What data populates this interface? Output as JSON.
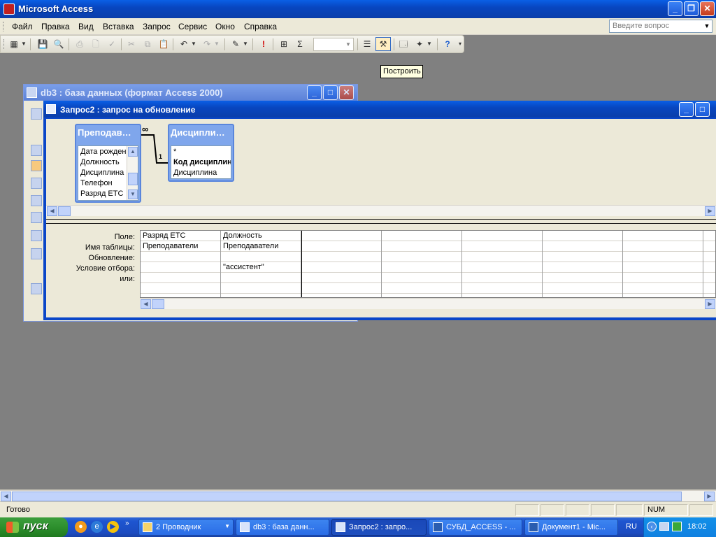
{
  "app": {
    "title": "Microsoft Access",
    "colors": {
      "title_blue": "#0a46c8",
      "face": "#ece9d8",
      "workspace": "#808080",
      "start_green": "#2d8f2d"
    }
  },
  "menubar": {
    "items": [
      "Файл",
      "Правка",
      "Вид",
      "Вставка",
      "Запрос",
      "Сервис",
      "Окно",
      "Справка"
    ],
    "ask_placeholder": "Введите вопрос"
  },
  "toolbar": {
    "sigma": "Σ",
    "tooltip": "Построить"
  },
  "db_window": {
    "title": "db3 : база данных (формат Access 2000)"
  },
  "query_window": {
    "title": "Запрос2 : запрос на обновление",
    "field_lists": [
      {
        "title": "Преподав…",
        "fields": [
          "Дата рождения",
          "Должность",
          "Дисциплина",
          "Телефон",
          "Разряд  ETC"
        ]
      },
      {
        "title": "Дисципли…",
        "fields": [
          "*",
          "Код дисциплины",
          "Дисциплина"
        ],
        "bold_field_index": 1
      }
    ],
    "relation": {
      "one_label": "1",
      "many_label": "∞"
    },
    "qbe": {
      "row_labels": [
        "Поле:",
        "Имя таблицы:",
        "Обновление:",
        "Условие отбора:",
        "или:"
      ],
      "columns": [
        {
          "field": "Разряд  ETC",
          "table": "Преподаватели",
          "update": "",
          "criteria": "",
          "or": ""
        },
        {
          "field": "Должность",
          "table": "Преподаватели",
          "update": "",
          "criteria": "\"ассистент\"",
          "or": ""
        }
      ]
    }
  },
  "statusbar": {
    "text": "Готово",
    "num": "NUM"
  },
  "taskbar": {
    "start_label": "пуск",
    "tasks": [
      {
        "label": "2 Проводник",
        "active": false
      },
      {
        "label": "db3 : база данн...",
        "active": false
      },
      {
        "label": "Запрос2 : запро...",
        "active": true
      },
      {
        "label": "СУБД_ACCESS - ...",
        "active": false
      },
      {
        "label": "Документ1 - Mic...",
        "active": false
      }
    ],
    "lang": "RU",
    "clock": "18:02"
  }
}
